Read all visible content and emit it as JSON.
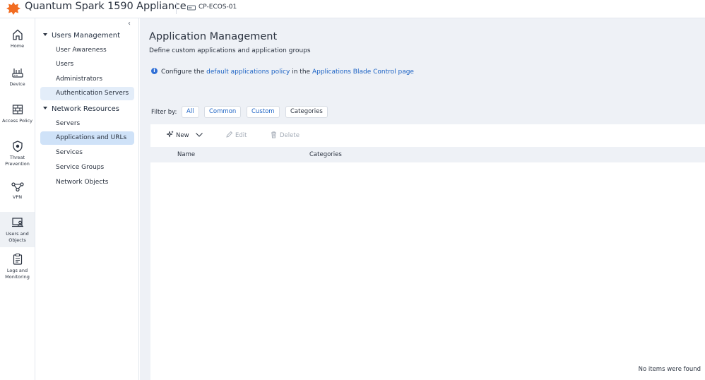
{
  "header": {
    "app_title": "Quantum Spark 1590 Appliance",
    "device_name": "CP-ECOS-01",
    "brand_color": "#f26c21"
  },
  "rail": [
    {
      "id": "home",
      "label": "Home",
      "icon": "home-icon"
    },
    {
      "id": "device",
      "label": "Device",
      "icon": "router-icon"
    },
    {
      "id": "access-policy",
      "label": "Access Policy",
      "icon": "firewall-icon"
    },
    {
      "id": "threat-prevention",
      "label": "Threat Prevention",
      "icon": "shield-icon"
    },
    {
      "id": "vpn",
      "label": "VPN",
      "icon": "network-nodes-icon"
    },
    {
      "id": "users-objects",
      "label": "Users and Objects",
      "icon": "user-monitor-icon",
      "active": true
    },
    {
      "id": "logs-monitoring",
      "label": "Logs and Monitoring",
      "icon": "clipboard-icon"
    }
  ],
  "tree": {
    "sections": [
      {
        "label": "Users Management",
        "items": [
          "User Awareness",
          "Users",
          "Administrators",
          "Authentication Servers"
        ]
      },
      {
        "label": "Network Resources",
        "items": [
          "Servers",
          "Applications and URLs",
          "Services",
          "Service Groups",
          "Network Objects"
        ]
      }
    ],
    "selected": "Applications and URLs"
  },
  "main": {
    "title": "Application Management",
    "subtitle": "Define custom applications and application groups",
    "info": {
      "prefix": "Configure the",
      "link1": "default applications policy",
      "middle": "in the",
      "link2": "Applications Blade Control page"
    },
    "filter": {
      "label": "Filter by:",
      "chips": [
        "All",
        "Common",
        "Custom",
        "Categories"
      ]
    },
    "toolbar": {
      "new": "New",
      "edit": "Edit",
      "delete": "Delete"
    },
    "table": {
      "columns": [
        "Name",
        "Categories"
      ],
      "empty_message": "No items were found"
    }
  }
}
